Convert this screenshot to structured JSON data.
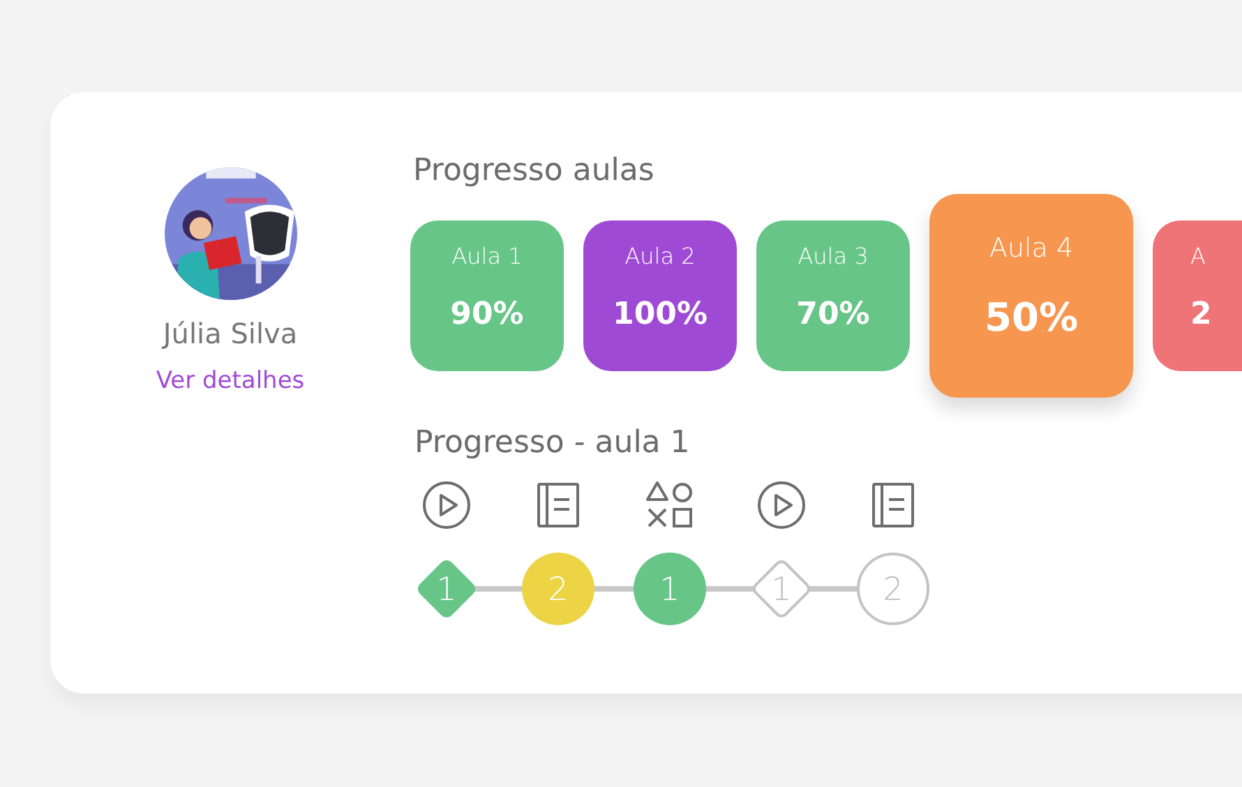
{
  "student": {
    "name": "Júlia Silva",
    "link": "Ver detalhes"
  },
  "lessons": {
    "title": "Progresso aulas",
    "cards": [
      {
        "label": "Aula 1",
        "value": "90%",
        "color": "#66c587",
        "selected": false
      },
      {
        "label": "Aula 2",
        "value": "100%",
        "color": "#9f4ad5",
        "selected": false
      },
      {
        "label": "Aula 3",
        "value": "70%",
        "color": "#66c587",
        "selected": false
      },
      {
        "label": "Aula 4",
        "value": "50%",
        "color": "#f7964f",
        "selected": true
      },
      {
        "label": "A",
        "value": "2",
        "color": "#ef7478",
        "selected": false
      }
    ]
  },
  "lesson_progress": {
    "title": "Progresso - aula 1",
    "steps": [
      {
        "kind": "video",
        "number": "1",
        "done": true,
        "color": "#66c587"
      },
      {
        "kind": "reading",
        "number": "2",
        "done": true,
        "color": "#ecd445"
      },
      {
        "kind": "activity",
        "number": "1",
        "done": true,
        "color": "#66c587"
      },
      {
        "kind": "video",
        "number": "1",
        "done": false,
        "color": "#c4c4c4"
      },
      {
        "kind": "reading",
        "number": "2",
        "done": false,
        "color": "#c4c4c4"
      }
    ]
  }
}
